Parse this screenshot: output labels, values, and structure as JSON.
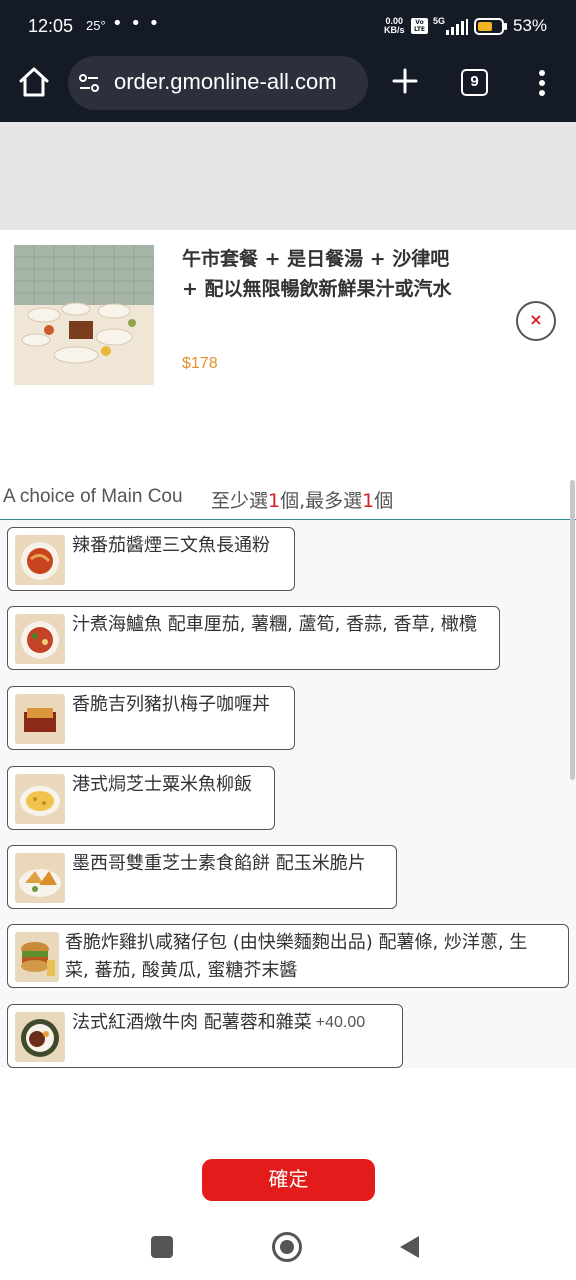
{
  "status_bar": {
    "time": "12:05",
    "temperature": "25°",
    "more": "• • •",
    "net_speed_value": "0.00",
    "net_speed_unit": "KB/s",
    "volte": "Vo LTE",
    "network": "5G",
    "battery_pct": "53%"
  },
  "browser": {
    "url": "order.gmonline-all.com",
    "tab_count": "9"
  },
  "product": {
    "title": "午市套餐 + 是日餐湯 + 沙律吧 + 配以無限暢飲新鮮果汁或汽水",
    "price": "$178",
    "close_icon": "×"
  },
  "options": {
    "label": "A choice of Main Cou",
    "rule_prefix": "至少選",
    "rule_min": "1",
    "rule_mid": "個,最多選",
    "rule_max": "1",
    "rule_suffix": "個",
    "items": [
      {
        "name": "辣番茄醬煙三文魚長通粉",
        "extra": ""
      },
      {
        "name": "汁煮海鱸魚 配車厘茄, 薯糰, 蘆筍, 香蒜, 香草, 橄欖",
        "extra": ""
      },
      {
        "name": "香脆吉列豬扒梅子咖喱丼",
        "extra": ""
      },
      {
        "name": "港式焗芝士粟米魚柳飯",
        "extra": ""
      },
      {
        "name": "墨西哥雙重芝士素食餡餅 配玉米脆片",
        "extra": ""
      },
      {
        "name": "香脆炸雞扒咸豬仔包 (由快樂麵麭出品) 配薯條, 炒洋蔥, 生菜, 蕃茄, 酸黄瓜, 蜜糖芥末醬",
        "line1": "香脆炸雞扒咸豬仔包 (由快樂麵麭出品) 配薯條, 炒洋蔥, 生",
        "line2": "菜, 蕃茄, 酸黄瓜, 蜜糖芥末醬",
        "extra": ""
      },
      {
        "name": "法式紅酒燉牛肉 配薯蓉和雜菜",
        "extra": "+40.00"
      }
    ]
  },
  "confirm_label": "確定",
  "colors": {
    "accent_red": "#e31b1b",
    "price_orange": "#e0932c",
    "chrome_bg": "#151a27"
  }
}
